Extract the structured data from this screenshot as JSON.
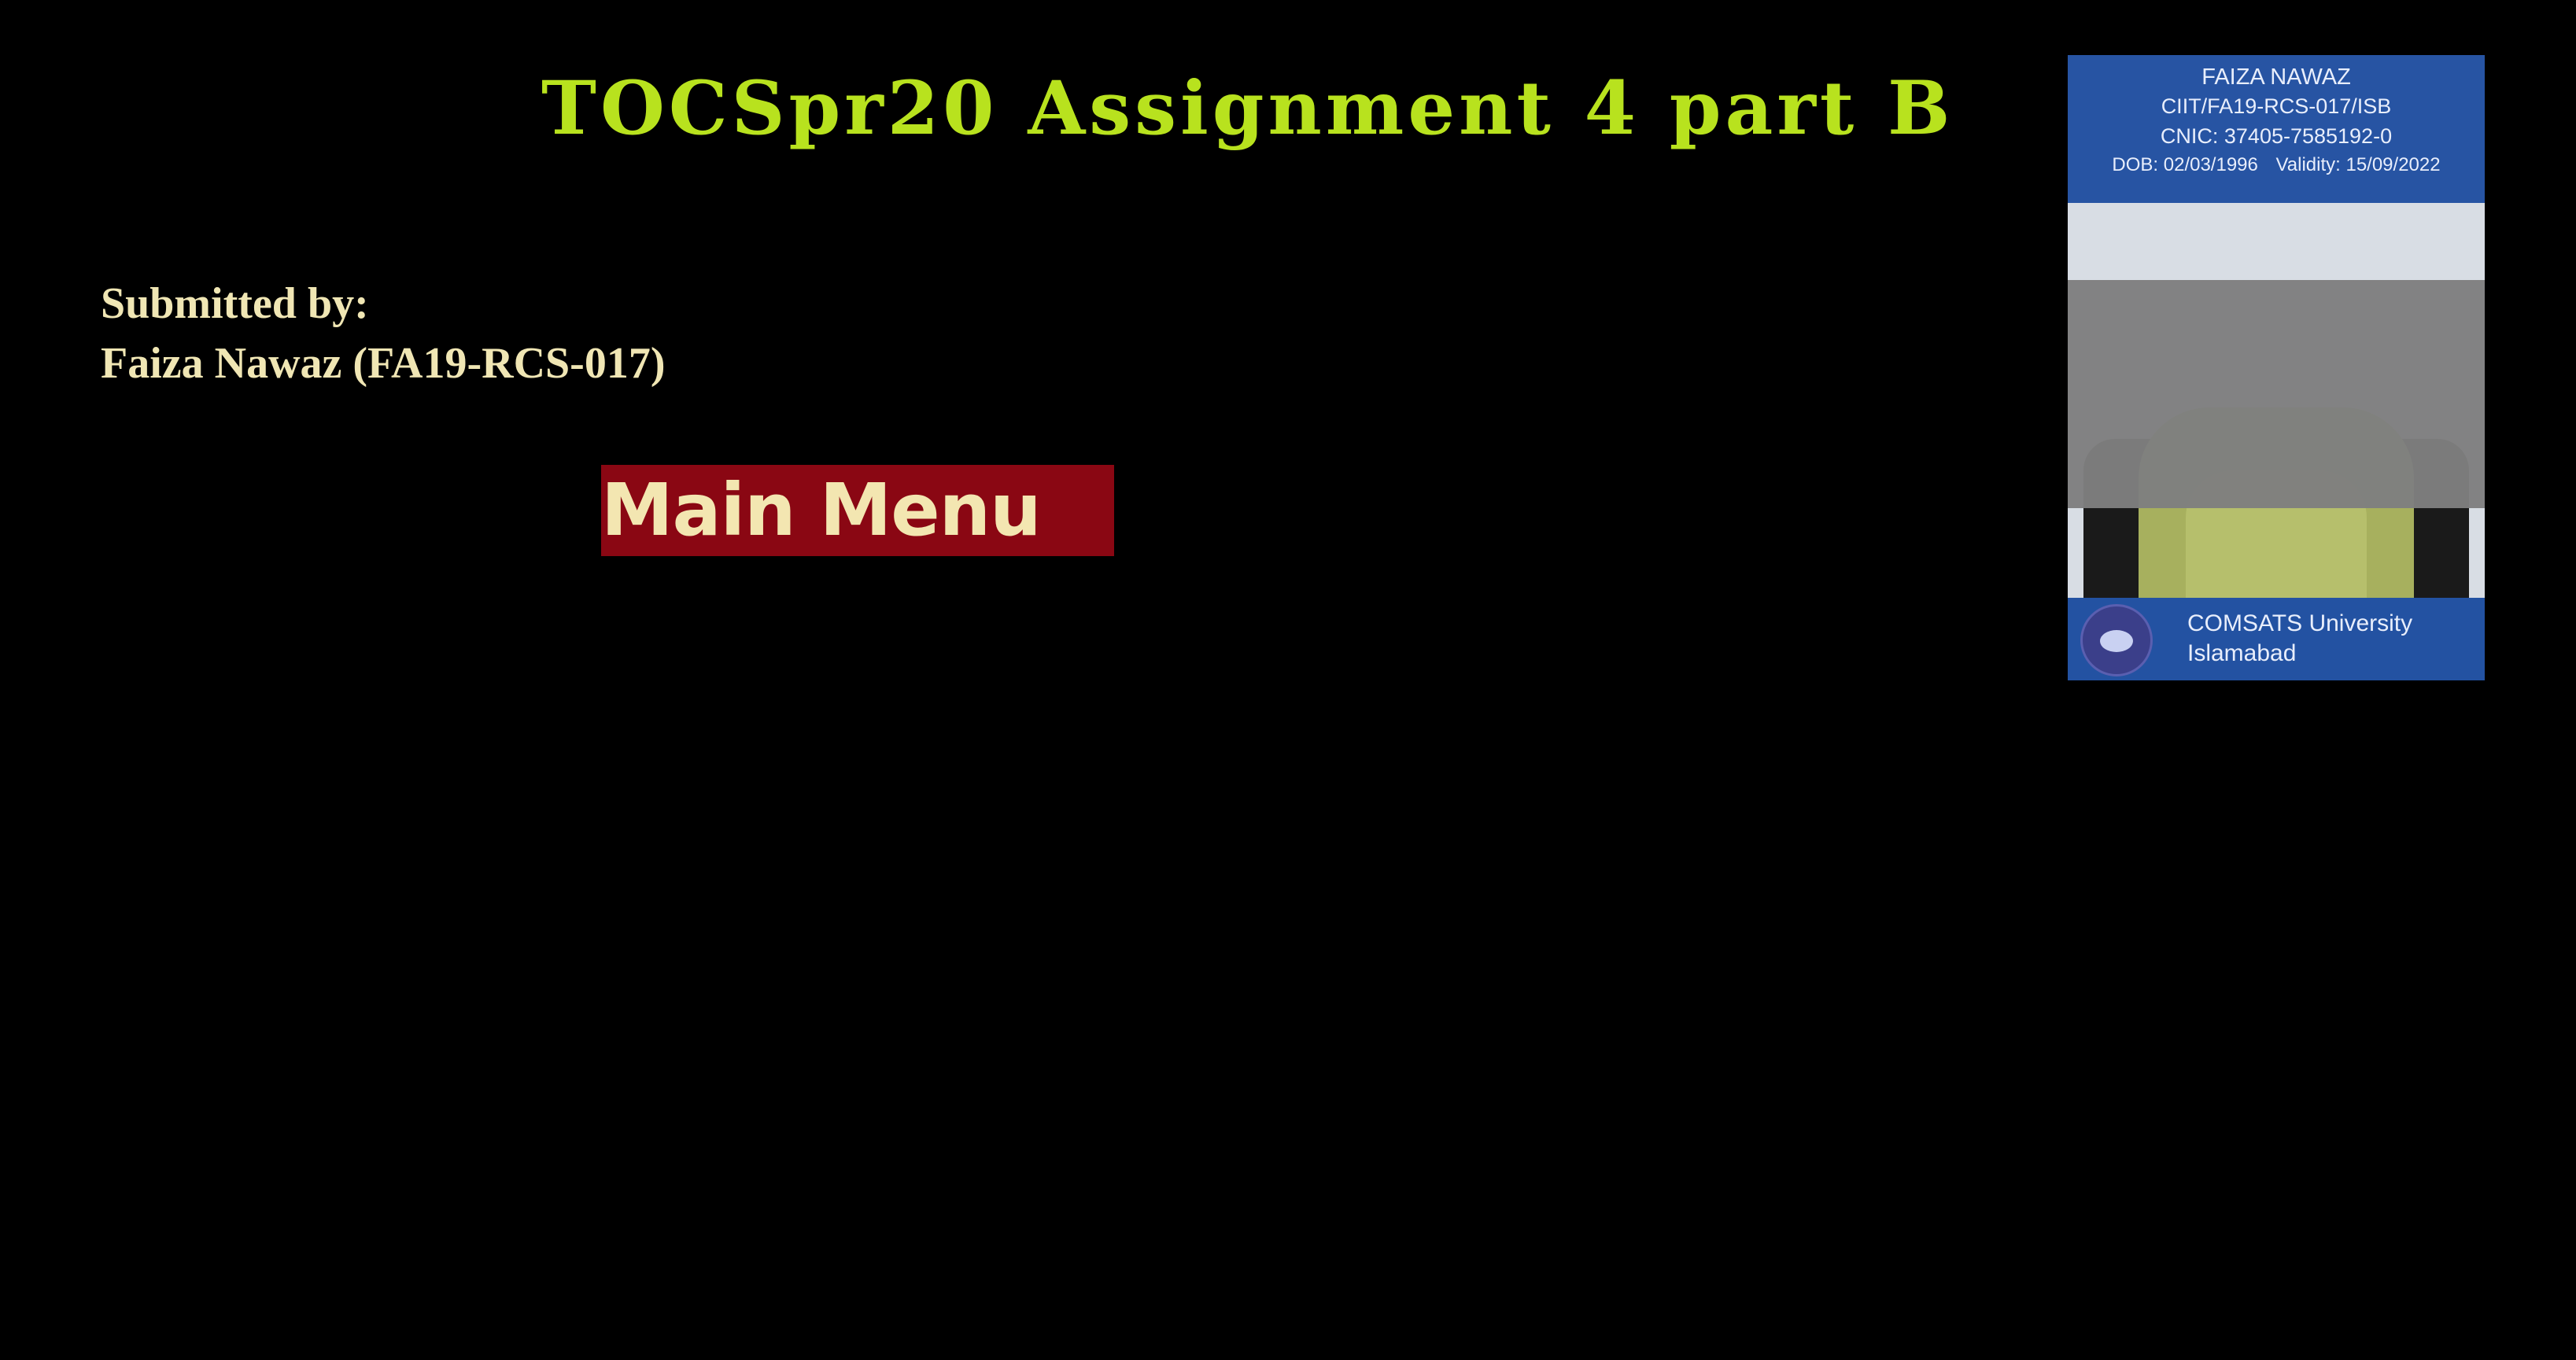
{
  "header": {
    "title": "TOCSpr20 Assignment 4 part B"
  },
  "submission": {
    "label": "Submitted by:",
    "author": "Faiza Nawaz (FA19-RCS-017)"
  },
  "menu": {
    "main_menu_label": "Main Menu"
  },
  "id_card": {
    "name": "FAIZA NAWAZ",
    "registration": "CIIT/FA19-RCS-017/ISB",
    "cnic": "CNIC: 37405-7585192-0",
    "dob": "DOB: 02/03/1996",
    "validity": "Validity: 15/09/2022",
    "university_line1": "COMSATS University",
    "university_line2": "Islamabad"
  },
  "colors": {
    "background": "#000000",
    "title": "#b8e21e",
    "text": "#f0e6b4",
    "button_bg": "#8a0713",
    "card_blue": "#2754a3"
  }
}
